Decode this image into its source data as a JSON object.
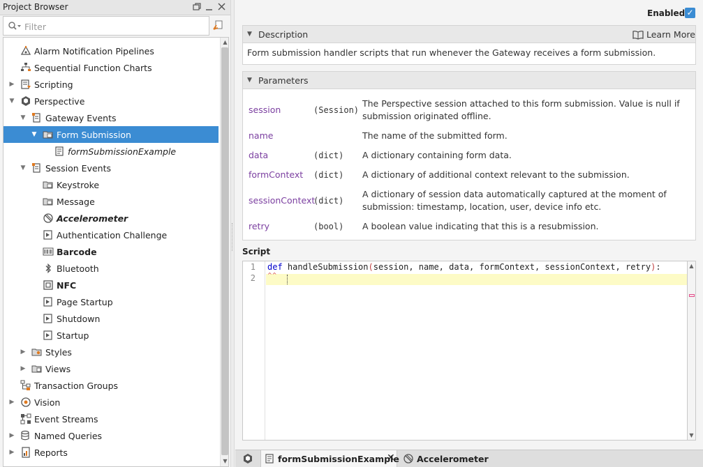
{
  "left_panel": {
    "title": "Project Browser",
    "filter_placeholder": "Filter",
    "tree": [
      {
        "label": "Alarm Notification Pipelines",
        "level": 1,
        "expander": "none",
        "icon": "alarm-pipeline-icon",
        "style": "normal"
      },
      {
        "label": "Sequential Function Charts",
        "level": 1,
        "expander": "none",
        "icon": "sfc-chart-icon",
        "style": "normal"
      },
      {
        "label": "Scripting",
        "level": 1,
        "expander": "collapsed",
        "icon": "scripting-icon",
        "style": "normal"
      },
      {
        "label": "Perspective",
        "level": 1,
        "expander": "expanded",
        "icon": "perspective-icon",
        "style": "normal"
      },
      {
        "label": "Gateway Events",
        "level": 2,
        "expander": "expanded",
        "icon": "gateway-events-icon",
        "style": "normal"
      },
      {
        "label": "Form Submission",
        "level": 3,
        "expander": "expanded",
        "icon": "folder-script-icon",
        "style": "normal",
        "selected": true
      },
      {
        "label": "formSubmissionExample",
        "level": 4,
        "expander": "none",
        "icon": "script-file-icon",
        "style": "italic"
      },
      {
        "label": "Session Events",
        "level": 2,
        "expander": "expanded",
        "icon": "session-events-icon",
        "style": "normal"
      },
      {
        "label": "Keystroke",
        "level": 3,
        "expander": "none",
        "icon": "folder-script-icon",
        "style": "normal"
      },
      {
        "label": "Message",
        "level": 3,
        "expander": "none",
        "icon": "folder-script-icon",
        "style": "normal"
      },
      {
        "label": "Accelerometer",
        "level": 3,
        "expander": "none",
        "icon": "accelerometer-icon",
        "style": "bolditalic"
      },
      {
        "label": "Authentication Challenge",
        "level": 3,
        "expander": "none",
        "icon": "session-script-icon",
        "style": "normal"
      },
      {
        "label": "Barcode",
        "level": 3,
        "expander": "none",
        "icon": "barcode-icon",
        "style": "bold"
      },
      {
        "label": "Bluetooth",
        "level": 3,
        "expander": "none",
        "icon": "bluetooth-icon",
        "style": "normal"
      },
      {
        "label": "NFC",
        "level": 3,
        "expander": "none",
        "icon": "nfc-icon",
        "style": "bold"
      },
      {
        "label": "Page Startup",
        "level": 3,
        "expander": "none",
        "icon": "session-script-icon",
        "style": "normal"
      },
      {
        "label": "Shutdown",
        "level": 3,
        "expander": "none",
        "icon": "session-script-icon",
        "style": "normal"
      },
      {
        "label": "Startup",
        "level": 3,
        "expander": "none",
        "icon": "session-script-icon",
        "style": "normal"
      },
      {
        "label": "Styles",
        "level": 2,
        "expander": "collapsed",
        "icon": "styles-folder-icon",
        "style": "normal"
      },
      {
        "label": "Views",
        "level": 2,
        "expander": "collapsed",
        "icon": "views-folder-icon",
        "style": "normal"
      },
      {
        "label": "Transaction Groups",
        "level": 1,
        "expander": "none",
        "icon": "transaction-groups-icon",
        "style": "normal"
      },
      {
        "label": "Vision",
        "level": 1,
        "expander": "collapsed",
        "icon": "vision-icon",
        "style": "normal"
      },
      {
        "label": "Event Streams",
        "level": 1,
        "expander": "none",
        "icon": "event-streams-icon",
        "style": "normal"
      },
      {
        "label": "Named Queries",
        "level": 1,
        "expander": "collapsed",
        "icon": "named-queries-icon",
        "style": "normal"
      },
      {
        "label": "Reports",
        "level": 1,
        "expander": "collapsed",
        "icon": "reports-icon",
        "style": "normal"
      }
    ]
  },
  "right_panel": {
    "enabled_label": "Enabled",
    "enabled_checked": true,
    "description": {
      "title": "Description",
      "learn_more": "Learn More",
      "text": "Form submission handler scripts that run whenever the Gateway receives a form submission."
    },
    "parameters": {
      "title": "Parameters",
      "items": [
        {
          "name": "session",
          "type": "(Session)",
          "desc": "The Perspective session attached to this form submission. Value is null if submission originated offline."
        },
        {
          "name": "name",
          "type": "",
          "desc": "The name of the submitted form."
        },
        {
          "name": "data",
          "type": "(dict)",
          "desc": "A dictionary containing form data."
        },
        {
          "name": "formContext",
          "type": "(dict)",
          "desc": "A dictionary of additional context relevant to the submission."
        },
        {
          "name": "sessionContext",
          "type": "(dict)",
          "desc": "A dictionary of session data automatically captured at the moment of submission: timestamp, location, user, device info etc."
        },
        {
          "name": "retry",
          "type": "(bool)",
          "desc": "A boolean value indicating that this is a resubmission."
        }
      ]
    },
    "script": {
      "label": "Script",
      "line_numbers": [
        "1",
        "2"
      ],
      "line1_keyword": "def",
      "line1_func": " handleSubmission",
      "line1_open": "(",
      "line1_args": "session, name, data, formContext, sessionContext, retry",
      "line1_close": ")",
      "line1_colon": ":",
      "line2": ""
    }
  },
  "tabs": {
    "active_label": "formSubmissionExample",
    "second_label": "Accelerometer"
  },
  "colors": {
    "selection": "#3b8cd3",
    "param_name": "#7b3fa0",
    "keyword": "#0000cc",
    "current_line": "#fdfbc6"
  }
}
